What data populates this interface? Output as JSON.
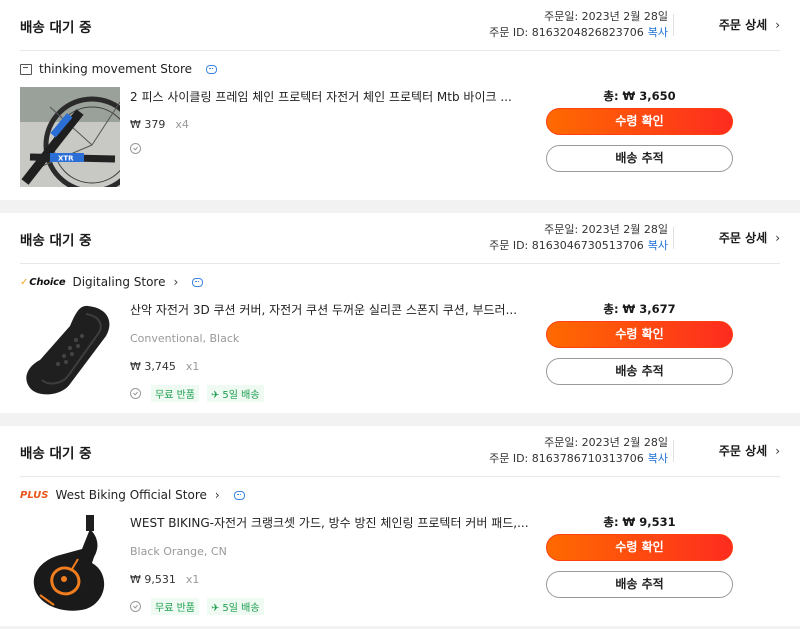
{
  "orders": [
    {
      "status": "배송 대기 중",
      "date_label": "주문일: 2023년 2월 28일",
      "id_label": "주문 ID: 8163204826823706",
      "copy_label": "복사",
      "detail_label": "주문 상세",
      "store_badge": "shop-icon",
      "store_name": "thinking movement Store",
      "title": "2 피스 사이클링 프레임 체인 프로텍터 자전거 체인 프로텍터 Mtb 바이크 ...",
      "variant": "",
      "price": "₩ 379",
      "qty": "x4",
      "tags": [],
      "total": "총: ₩ 3,650",
      "confirm_label": "수령 확인",
      "track_label": "배송 추적"
    },
    {
      "status": "배송 대기 중",
      "date_label": "주문일: 2023년 2월 28일",
      "id_label": "주문 ID: 8163046730513706",
      "copy_label": "복사",
      "detail_label": "주문 상세",
      "store_badge": "choice-badge",
      "store_badge_text": "Choice",
      "store_name": "Digitaling Store",
      "title": "산악 자전거 3D 쿠션 커버, 자전거 쿠션 두꺼운 실리콘 스폰지 쿠션, 부드러...",
      "variant": "Conventional, Black",
      "price": "₩ 3,745",
      "qty": "x1",
      "tags": [
        "무료 반품",
        "5일 배송"
      ],
      "total": "총: ₩ 3,677",
      "confirm_label": "수령 확인",
      "track_label": "배송 추적"
    },
    {
      "status": "배송 대기 중",
      "date_label": "주문일: 2023년 2월 28일",
      "id_label": "주문 ID: 8163786710313706",
      "copy_label": "복사",
      "detail_label": "주문 상세",
      "store_badge": "plus-badge",
      "store_badge_text": "PLUS",
      "store_name": "West Biking Official Store",
      "title": "WEST BIKING-자전거 크랭크셋 가드, 방수 방진 체인링 프로텍터 커버 패드,...",
      "variant": "Black Orange, CN",
      "price": "₩ 9,531",
      "qty": "x1",
      "tags": [
        "무료 반품",
        "5일 배송"
      ],
      "total": "총: ₩ 9,531",
      "confirm_label": "수령 확인",
      "track_label": "배송 추적"
    }
  ],
  "icons": {
    "chevron": "›",
    "plane": "✈"
  }
}
